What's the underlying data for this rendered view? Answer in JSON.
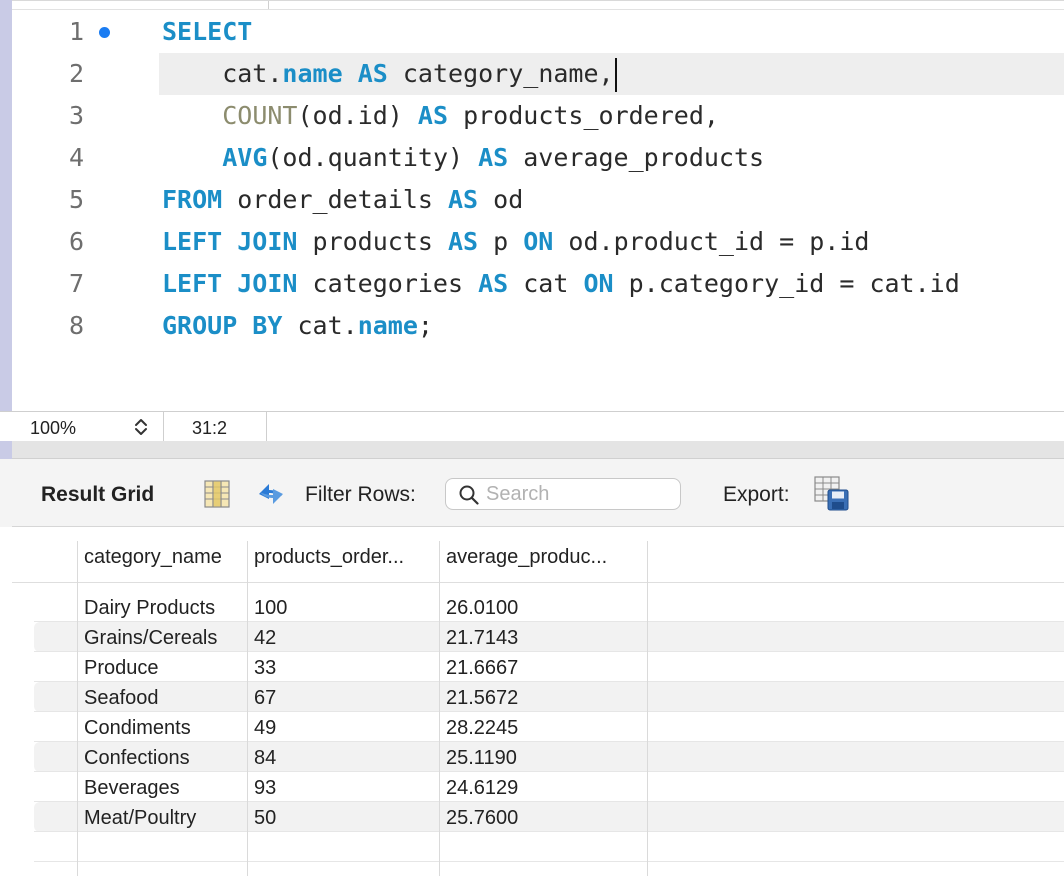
{
  "editor": {
    "lines": [
      {
        "num": "1",
        "tokens": [
          {
            "t": "SELECT",
            "c": "kw"
          }
        ]
      },
      {
        "num": "2",
        "tokens": [
          {
            "t": "    cat.",
            "c": ""
          },
          {
            "t": "name",
            "c": "kw"
          },
          {
            "t": " ",
            "c": ""
          },
          {
            "t": "AS",
            "c": "kw"
          },
          {
            "t": " category_name,",
            "c": ""
          }
        ],
        "cursor": true
      },
      {
        "num": "3",
        "tokens": [
          {
            "t": "    ",
            "c": ""
          },
          {
            "t": "COUNT",
            "c": "fn"
          },
          {
            "t": "(od.id) ",
            "c": ""
          },
          {
            "t": "AS",
            "c": "kw"
          },
          {
            "t": " products_ordered,",
            "c": ""
          }
        ]
      },
      {
        "num": "4",
        "tokens": [
          {
            "t": "    ",
            "c": ""
          },
          {
            "t": "AVG",
            "c": "kw"
          },
          {
            "t": "(od.quantity) ",
            "c": ""
          },
          {
            "t": "AS",
            "c": "kw"
          },
          {
            "t": " average_products",
            "c": ""
          }
        ]
      },
      {
        "num": "5",
        "tokens": [
          {
            "t": "FROM",
            "c": "kw"
          },
          {
            "t": " order_details ",
            "c": ""
          },
          {
            "t": "AS",
            "c": "kw"
          },
          {
            "t": " od",
            "c": ""
          }
        ]
      },
      {
        "num": "6",
        "tokens": [
          {
            "t": "LEFT JOIN",
            "c": "kw"
          },
          {
            "t": " products ",
            "c": ""
          },
          {
            "t": "AS",
            "c": "kw"
          },
          {
            "t": " p ",
            "c": ""
          },
          {
            "t": "ON",
            "c": "kw"
          },
          {
            "t": " od.product_id = p.id",
            "c": ""
          }
        ]
      },
      {
        "num": "7",
        "tokens": [
          {
            "t": "LEFT JOIN",
            "c": "kw"
          },
          {
            "t": " categories ",
            "c": ""
          },
          {
            "t": "AS",
            "c": "kw"
          },
          {
            "t": " cat ",
            "c": ""
          },
          {
            "t": "ON",
            "c": "kw"
          },
          {
            "t": " p.category_id = cat.id",
            "c": ""
          }
        ]
      },
      {
        "num": "8",
        "tokens": [
          {
            "t": "GROUP BY",
            "c": "kw"
          },
          {
            "t": " cat.",
            "c": ""
          },
          {
            "t": "name",
            "c": "kw"
          },
          {
            "t": ";",
            "c": ""
          }
        ]
      }
    ]
  },
  "status": {
    "zoom": "100%",
    "cursor_position": "31:2"
  },
  "toolbar": {
    "title": "Result Grid",
    "filter_label": "Filter Rows:",
    "search_placeholder": "Search",
    "search_value": "",
    "export_label": "Export:"
  },
  "result": {
    "columns": [
      "category_name",
      "products_order...",
      "average_produc..."
    ],
    "rows": [
      [
        "Dairy Products",
        "100",
        "26.0100"
      ],
      [
        "Grains/Cereals",
        "42",
        "21.7143"
      ],
      [
        "Produce",
        "33",
        "21.6667"
      ],
      [
        "Seafood",
        "67",
        "21.5672"
      ],
      [
        "Condiments",
        "49",
        "28.2245"
      ],
      [
        "Confections",
        "84",
        "25.1190"
      ],
      [
        "Beverages",
        "93",
        "24.6129"
      ],
      [
        "Meat/Poultry",
        "50",
        "25.7600"
      ]
    ]
  },
  "colors": {
    "keyword": "#1b8ec7",
    "function": "#8c8c6e",
    "marker": "#1a7cf2",
    "refresh_icon": "#2b7bd6"
  },
  "icons": [
    "breakpoint-dot",
    "zoom-stepper-icon",
    "grid-columns-icon",
    "refresh-icon",
    "search-icon",
    "export-icon"
  ]
}
